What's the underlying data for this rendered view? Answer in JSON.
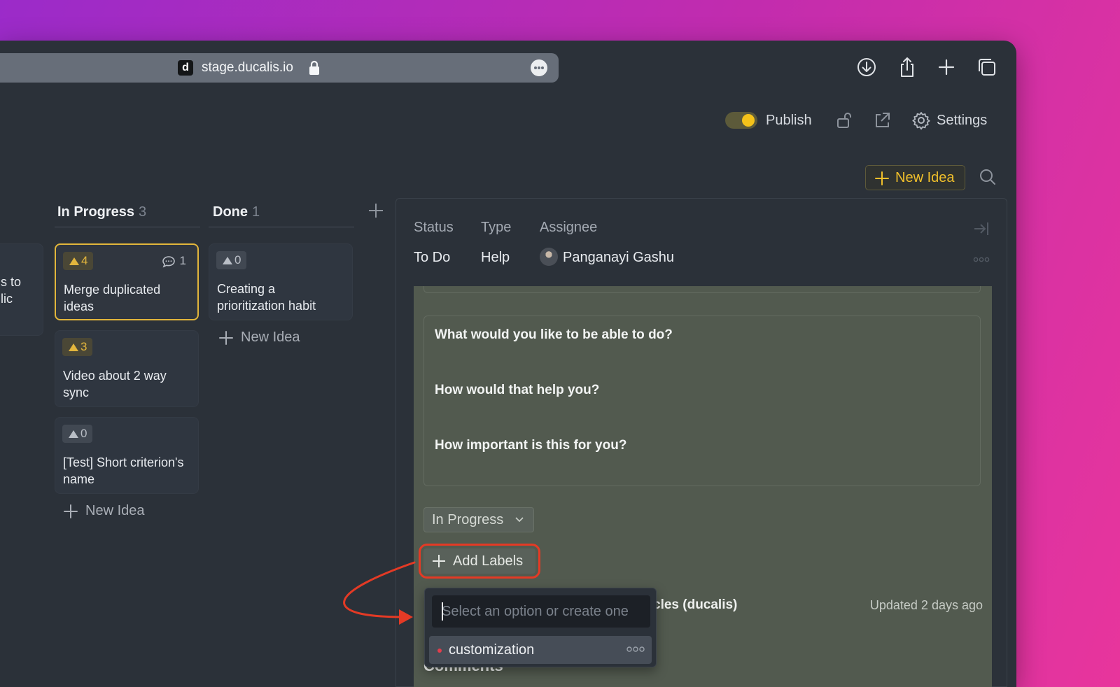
{
  "browser": {
    "favicon_letter": "d",
    "url": "stage.ducalis.io",
    "icons": [
      "download-icon",
      "share-icon",
      "new-tab-icon",
      "tabs-overview-icon"
    ]
  },
  "header": {
    "publish_label": "Publish",
    "settings_label": "Settings",
    "new_idea_label": "New Idea",
    "accent": "#f0bf2b"
  },
  "board": {
    "partial_card_text": [
      "s to",
      "lic"
    ],
    "columns": [
      {
        "title": "In Progress",
        "count": "3",
        "cards": [
          {
            "votes": "4",
            "comments": "1",
            "title": "Merge duplicated ideas",
            "active": true
          },
          {
            "votes": "3",
            "title": "Video about 2 way sync"
          },
          {
            "votes": "0",
            "title": "[Test] Short criterion's name"
          }
        ],
        "new_idea_label": "New Idea"
      },
      {
        "title": "Done",
        "count": "1",
        "cards": [
          {
            "votes": "0",
            "title": "Creating a prioritization habit"
          }
        ],
        "new_idea_label": "New Idea"
      }
    ]
  },
  "panel": {
    "status_label": "Status",
    "status_value": "To Do",
    "type_label": "Type",
    "type_value": "Help",
    "assignee_label": "Assignee",
    "assignee_value": "Panganayi Gashu",
    "questions": [
      "What would you like to be able to do?",
      "How would that help you?",
      "How important is this for you?"
    ],
    "stage_select": "In Progress",
    "add_labels": "Add Labels",
    "owner_partial": "cles (ducalis)",
    "updated": "Updated 2 days ago",
    "comments_partial": "Comments"
  },
  "label_dropdown": {
    "placeholder": "Select an option or create one",
    "options": [
      {
        "label": "customization",
        "color": "#e23d4c"
      }
    ]
  },
  "annotation_color": "#e43a25"
}
